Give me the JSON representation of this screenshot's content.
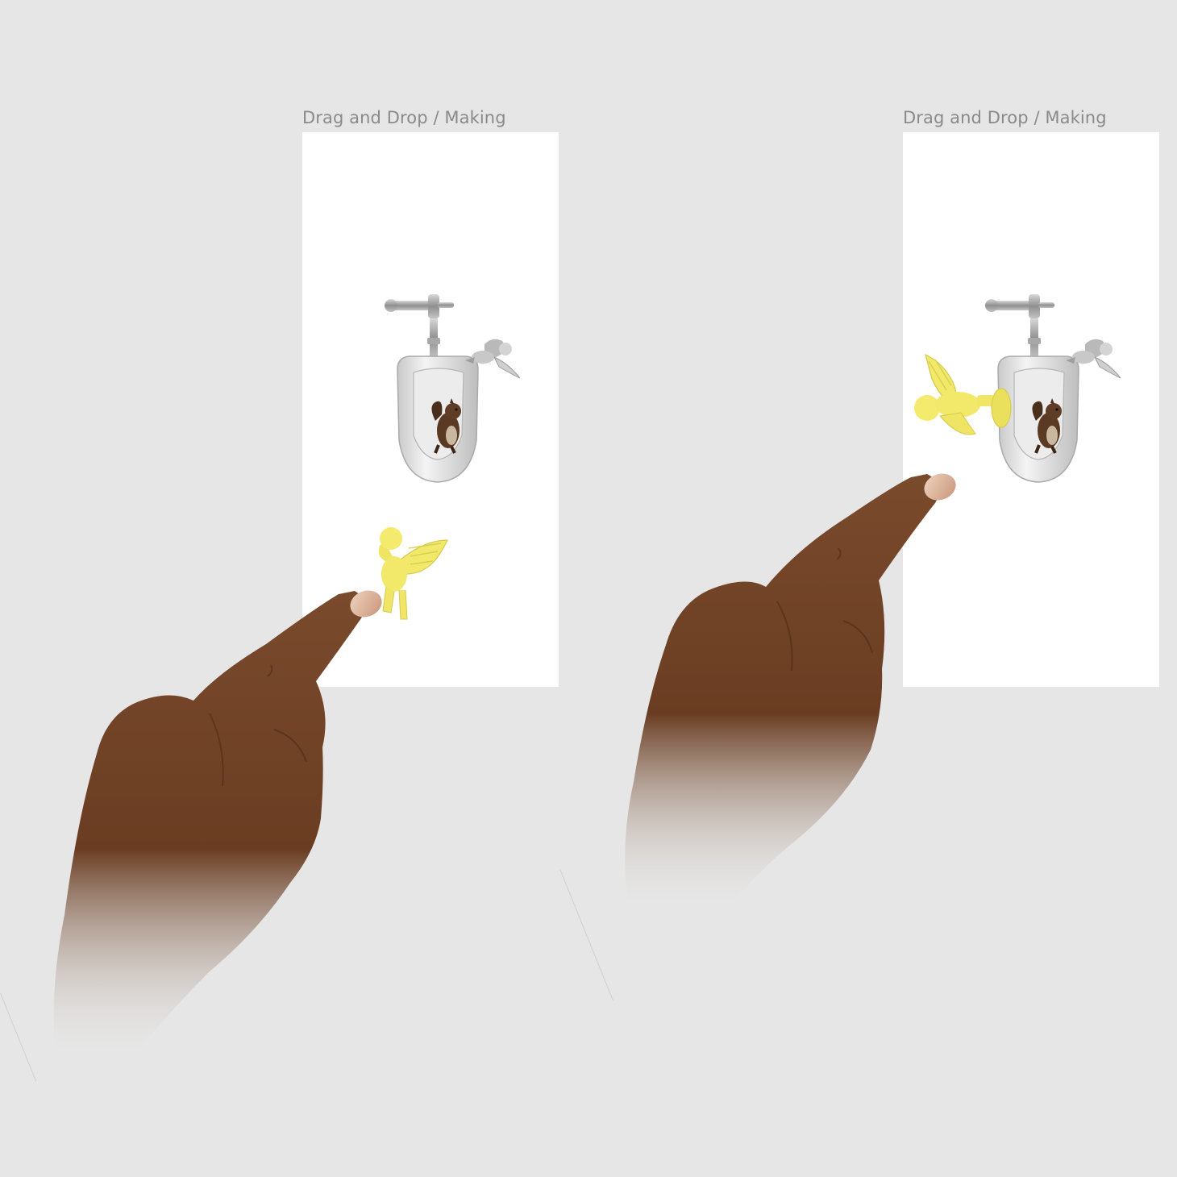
{
  "frames": [
    {
      "label": "Drag and Drop / Making",
      "state": "dragging"
    },
    {
      "label": "Drag and Drop / Making",
      "state": "dropped"
    }
  ],
  "scene_objects": [
    "flush-valve",
    "urinal",
    "squirrel",
    "grey-cherub",
    "yellow-cherub",
    "pointing-hand"
  ],
  "colors": {
    "canvas": "#e6e6e6",
    "frame": "#ffffff",
    "label": "#8a8a8a",
    "highlight_object": "#f2e86a",
    "skin": "#7a4a2c"
  }
}
